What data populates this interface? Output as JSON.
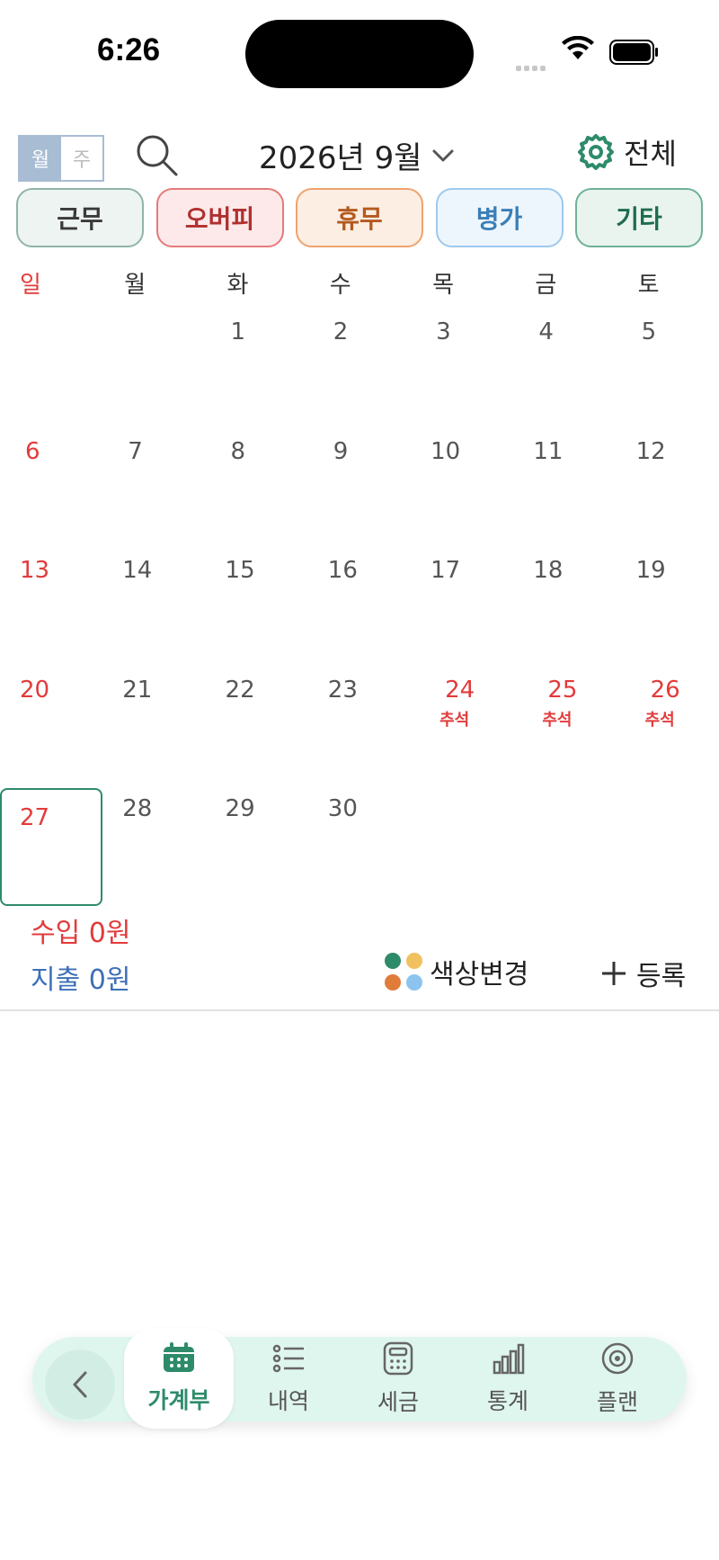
{
  "status_bar": {
    "time": "6:26"
  },
  "header": {
    "view_toggle": {
      "month": "월",
      "week": "주"
    },
    "title": "2026년 9월",
    "filter_label": "전체"
  },
  "chips": [
    {
      "label": "근무",
      "color": "#2e8b6a",
      "text": "#3a3a3a",
      "bg": "#eef4f1",
      "border": "#8fb5a6"
    },
    {
      "label": "오버피",
      "color": "#c0392b",
      "text": "#b03030",
      "bg": "#fde9e9",
      "border": "#e47a7a"
    },
    {
      "label": "휴무",
      "color": "#e07b39",
      "text": "#b35a1f",
      "bg": "#fdeee4",
      "border": "#eda36e"
    },
    {
      "label": "병가",
      "color": "#5aa9e6",
      "text": "#3b7fb6",
      "bg": "#eef6fd",
      "border": "#9ccaee"
    },
    {
      "label": "기타",
      "color": "#2e8b6a",
      "text": "#1f6b4e",
      "bg": "#e9f4ef",
      "border": "#6fb196"
    }
  ],
  "weekdays": [
    "일",
    "월",
    "화",
    "수",
    "목",
    "금",
    "토"
  ],
  "weeks": [
    [
      {
        "n": ""
      },
      {
        "n": ""
      },
      {
        "n": "1"
      },
      {
        "n": "2"
      },
      {
        "n": "3"
      },
      {
        "n": "4"
      },
      {
        "n": "5"
      }
    ],
    [
      {
        "n": "6"
      },
      {
        "n": "7"
      },
      {
        "n": "8"
      },
      {
        "n": "9"
      },
      {
        "n": "10"
      },
      {
        "n": "11"
      },
      {
        "n": "12"
      }
    ],
    [
      {
        "n": "13"
      },
      {
        "n": "14"
      },
      {
        "n": "15"
      },
      {
        "n": "16"
      },
      {
        "n": "17"
      },
      {
        "n": "18"
      },
      {
        "n": "19"
      }
    ],
    [
      {
        "n": "20"
      },
      {
        "n": "21"
      },
      {
        "n": "22"
      },
      {
        "n": "23"
      },
      {
        "n": "24",
        "holiday": "추석"
      },
      {
        "n": "25",
        "holiday": "추석"
      },
      {
        "n": "26",
        "holiday": "추석"
      }
    ],
    [
      {
        "n": "27"
      },
      {
        "n": "28"
      },
      {
        "n": "29"
      },
      {
        "n": "30"
      },
      {
        "n": ""
      },
      {
        "n": ""
      },
      {
        "n": ""
      }
    ]
  ],
  "summary": {
    "income": "수입 0원",
    "expense": "지출 0원",
    "color_change": "색상변경",
    "register": "등록"
  },
  "dot_colors": [
    "#2e8b6a",
    "#f2c15f",
    "#e07b39",
    "#8cc4ef"
  ],
  "tabbar": {
    "tabs": [
      {
        "label": "가계부",
        "icon": "calendar-icon",
        "active": true
      },
      {
        "label": "내역",
        "icon": "list-icon"
      },
      {
        "label": "세금",
        "icon": "calculator-icon"
      },
      {
        "label": "통계",
        "icon": "bar-chart-icon"
      },
      {
        "label": "플랜",
        "icon": "target-icon"
      }
    ]
  },
  "colors": {
    "accent": "#2e8b6a",
    "sunday": "#e23b3b",
    "expense": "#3d6fb8"
  }
}
